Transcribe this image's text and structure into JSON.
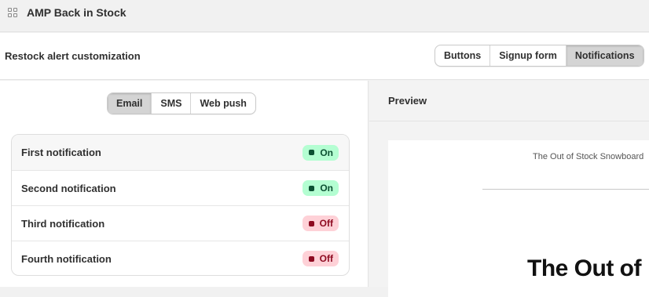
{
  "app": {
    "title": "AMP Back in Stock",
    "icon": "app-grid-icon"
  },
  "section": {
    "title": "Restock alert customization",
    "view_tabs": [
      {
        "label": "Buttons",
        "active": false
      },
      {
        "label": "Signup form",
        "active": false
      },
      {
        "label": "Notifications",
        "active": true
      }
    ]
  },
  "channels": [
    {
      "label": "Email",
      "active": true
    },
    {
      "label": "SMS",
      "active": false
    },
    {
      "label": "Web push",
      "active": false
    }
  ],
  "notifications": [
    {
      "label": "First notification",
      "status": "On",
      "state": "on"
    },
    {
      "label": "Second notification",
      "status": "On",
      "state": "on"
    },
    {
      "label": "Third notification",
      "status": "Off",
      "state": "off"
    },
    {
      "label": "Fourth notification",
      "status": "Off",
      "state": "off"
    }
  ],
  "preview": {
    "title": "Preview",
    "email_subject": "The Out of Stock Snowboard",
    "email_heading": "The Out of"
  },
  "colors": {
    "on_badge_bg": "#b4fed2",
    "on_badge_text": "#0c5132",
    "off_badge_bg": "#fed1d7",
    "off_badge_text": "#8e0b21",
    "active_segment": "#d4d4d4"
  }
}
